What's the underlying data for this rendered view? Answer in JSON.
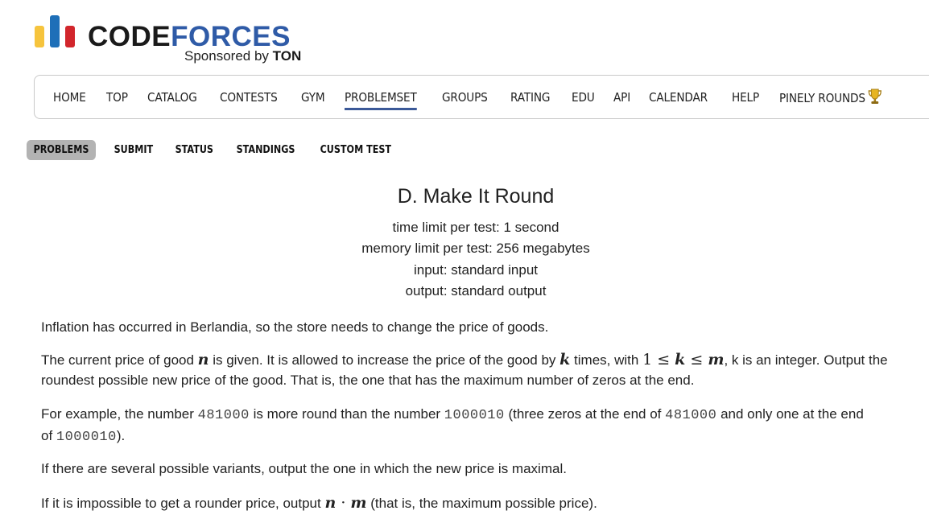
{
  "logo": {
    "word_code": "CODE",
    "word_forces": "FORCES",
    "sponsor_prefix": "Sponsored by",
    "sponsor_name": "TON",
    "bar_colors": [
      "#f6c43d",
      "#1e6fb8",
      "#d2262c"
    ]
  },
  "nav": {
    "items": [
      "HOME",
      "TOP",
      "CATALOG",
      "CONTESTS",
      "GYM",
      "PROBLEMSET",
      "GROUPS",
      "RATING",
      "EDU",
      "API",
      "CALENDAR",
      "HELP",
      "PINELY ROUNDS"
    ],
    "active": "PROBLEMSET",
    "trophy_icon": "trophy-icon"
  },
  "submenu": {
    "items": [
      "PROBLEMS",
      "SUBMIT",
      "STATUS",
      "STANDINGS",
      "CUSTOM TEST"
    ],
    "selected": "PROBLEMS"
  },
  "problem": {
    "title": "D. Make It Round",
    "time_limit": "time limit per test: 1 second",
    "memory_limit": "memory limit per test: 256 megabytes",
    "input": "input: standard input",
    "output": "output: standard output"
  },
  "statement": {
    "p1": "Inflation has occurred in Berlandia, so the store needs to change the price of goods.",
    "p2_a": "The current price of good ",
    "p2_n": "n",
    "p2_b": " is given. It is allowed to increase the price of the good by ",
    "p2_k": "k",
    "p2_c": " times, with ",
    "p2_ineq_1": "1",
    "p2_ineq_le1": " ≤ ",
    "p2_ineq_k": "k",
    "p2_ineq_le2": " ≤ ",
    "p2_ineq_m": "m",
    "p2_d": ", k is an integer. Output the",
    "p2_e": "roundest possible new price of the good. That is, the one that has the maximum number of zeros at the end.",
    "p3_a": "For example, the number ",
    "p3_num1": "481000",
    "p3_b": " is more round than the number ",
    "p3_num2": "1000010",
    "p3_c": " (three zeros at the end of ",
    "p3_num3": "481000",
    "p3_d": " and only one at the end",
    "p3_e": "of ",
    "p3_num4": "1000010",
    "p3_f": ").",
    "p4": "If there are several possible variants, output the one in which the new price is maximal.",
    "p5_a": "If it is impossible to get a rounder price, output ",
    "p5_n": "n",
    "p5_dot": " · ",
    "p5_m": "m",
    "p5_b": " (that is, the maximum possible price)."
  }
}
